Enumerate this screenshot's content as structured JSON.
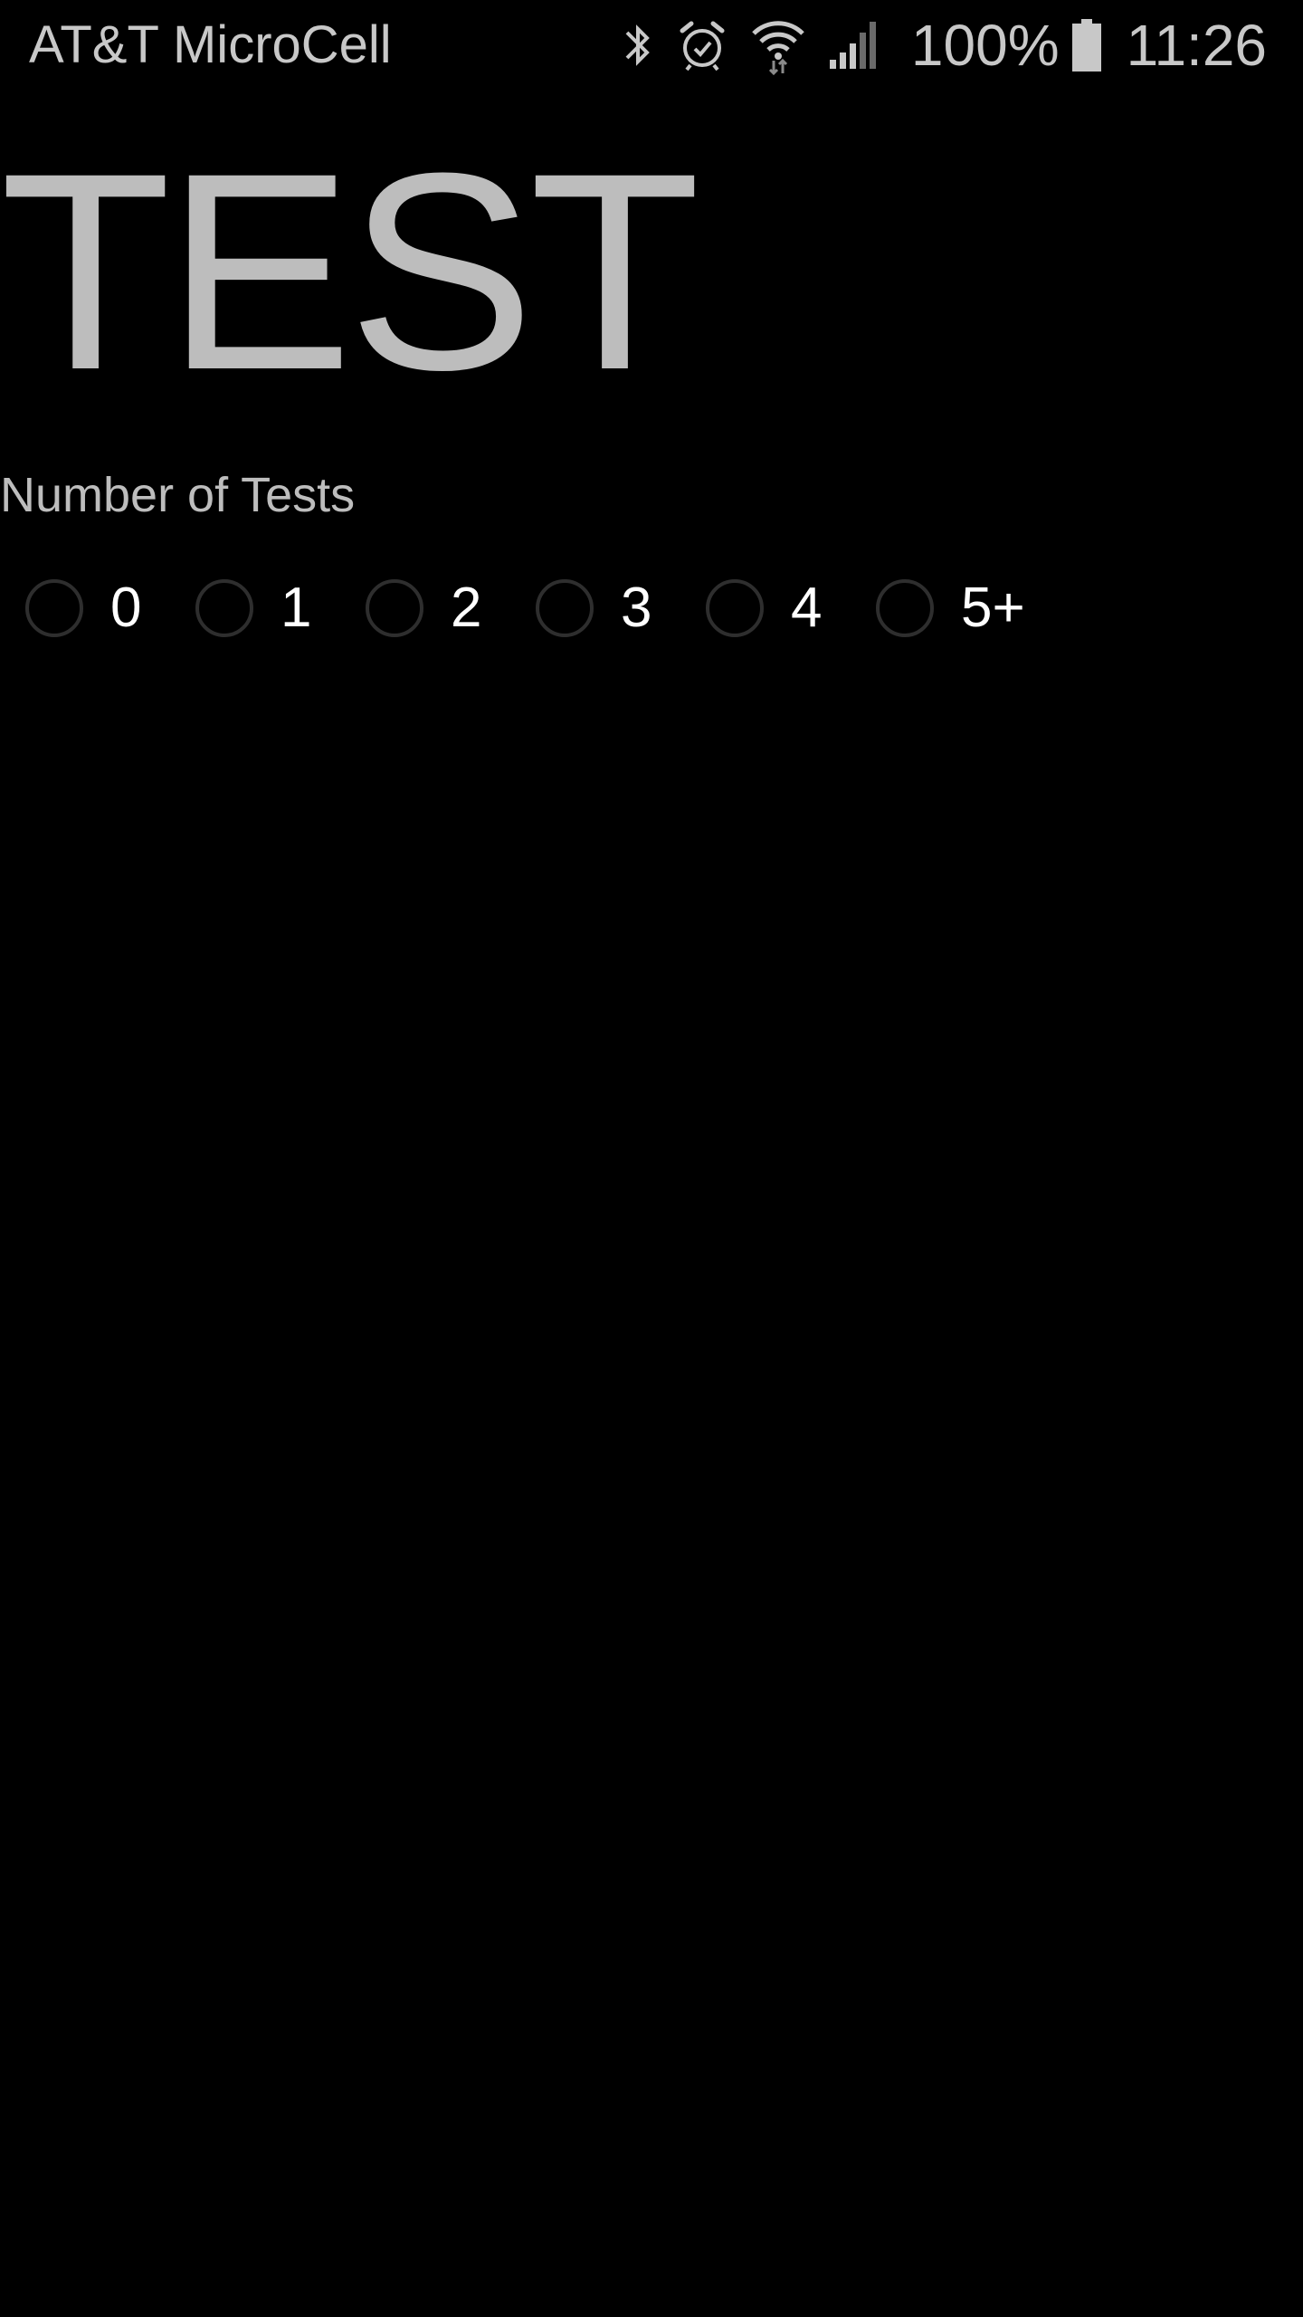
{
  "status_bar": {
    "carrier": "AT&T MicroCell",
    "icons": [
      "bluetooth-icon",
      "alarm-icon",
      "wifi-icon",
      "cell-signal-icon",
      "battery-icon"
    ],
    "battery_percent": "100%",
    "time": "11:26"
  },
  "main": {
    "title": "TEST",
    "question_label": "Number of Tests",
    "options": [
      {
        "label": "0",
        "selected": false
      },
      {
        "label": "1",
        "selected": false
      },
      {
        "label": "2",
        "selected": false
      },
      {
        "label": "3",
        "selected": false
      },
      {
        "label": "4",
        "selected": false
      },
      {
        "label": "5+",
        "selected": false
      }
    ]
  },
  "colors": {
    "background": "#000000",
    "text_primary": "#bdbdbd",
    "option_text": "#ffffff",
    "radio_border": "#2e2e2e"
  }
}
